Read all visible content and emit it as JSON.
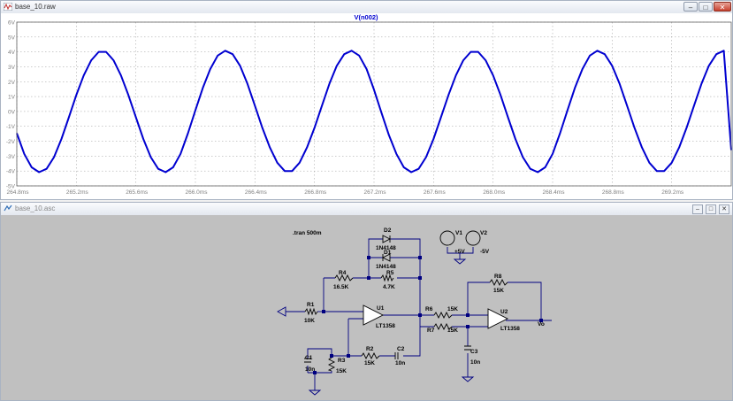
{
  "plot_window": {
    "title": "base_10.raw",
    "icon": "waveform-icon",
    "controls": [
      "–",
      "□",
      "✕"
    ],
    "trace_label": "V(n002)"
  },
  "chart_data": {
    "type": "line",
    "title": "V(n002)",
    "xlabel": "",
    "ylabel": "",
    "x_unit": "ms",
    "y_unit": "V",
    "xlim": [
      264.8,
      269.6
    ],
    "ylim": [
      -5,
      6
    ],
    "x_ticks": [
      "264.8ms",
      "265.2ms",
      "265.6ms",
      "266.0ms",
      "266.4ms",
      "266.8ms",
      "267.2ms",
      "267.6ms",
      "268.0ms",
      "268.4ms",
      "268.8ms",
      "269.2ms"
    ],
    "x_tick_values": [
      264.8,
      265.2,
      265.6,
      266.0,
      266.4,
      266.8,
      267.2,
      267.6,
      268.0,
      268.4,
      268.8,
      269.2
    ],
    "y_ticks": [
      "6V",
      "5V",
      "4V",
      "3V",
      "2V",
      "1V",
      "0V",
      "-1V",
      "-2V",
      "-3V",
      "-4V",
      "-5V"
    ],
    "y_tick_values": [
      6,
      5,
      4,
      3,
      2,
      1,
      0,
      -1,
      -2,
      -3,
      -4,
      -5
    ],
    "grid": true,
    "series": [
      {
        "name": "V(n002)",
        "color": "#0000d0",
        "x": [
          264.8,
          264.85,
          264.9,
          264.95,
          265.0,
          265.05,
          265.1,
          265.15,
          265.2,
          265.25,
          265.3,
          265.35,
          265.4,
          265.45,
          265.5,
          265.55,
          265.6,
          265.65,
          265.7,
          265.75,
          265.8,
          265.85,
          265.9,
          265.95,
          266.0,
          266.05,
          266.1,
          266.15,
          266.2,
          266.25,
          266.3,
          266.35,
          266.4,
          266.45,
          266.5,
          266.55,
          266.6,
          266.65,
          266.7,
          266.75,
          266.8,
          266.85,
          266.9,
          266.95,
          267.0,
          267.05,
          267.1,
          267.15,
          267.2,
          267.25,
          267.3,
          267.35,
          267.4,
          267.45,
          267.5,
          267.55,
          267.6,
          267.65,
          267.7,
          267.75,
          267.8,
          267.85,
          267.9,
          267.95,
          268.0,
          268.05,
          268.1,
          268.15,
          268.2,
          268.25,
          268.3,
          268.35,
          268.4,
          268.45,
          268.5,
          268.55,
          268.6,
          268.65,
          268.7,
          268.75,
          268.8,
          268.85,
          268.9,
          268.95,
          269.0,
          269.05,
          269.1,
          269.15,
          269.2,
          269.25,
          269.3,
          269.35,
          269.4,
          269.45,
          269.5,
          269.55,
          269.6
        ],
        "y": [
          -1.46,
          -2.85,
          -3.75,
          -4.08,
          -3.85,
          -3.07,
          -1.85,
          -0.39,
          1.1,
          2.42,
          3.44,
          4.0,
          4.0,
          3.44,
          2.42,
          1.1,
          -0.39,
          -1.85,
          -3.07,
          -3.85,
          -4.08,
          -3.75,
          -2.85,
          -1.46,
          0.08,
          1.58,
          2.85,
          3.75,
          4.08,
          3.85,
          3.07,
          1.85,
          0.39,
          -1.1,
          -2.42,
          -3.44,
          -4.0,
          -4.0,
          -3.44,
          -2.42,
          -1.1,
          0.39,
          1.85,
          3.07,
          3.85,
          4.08,
          3.75,
          2.85,
          1.46,
          -0.08,
          -1.58,
          -2.85,
          -3.75,
          -4.08,
          -3.85,
          -3.07,
          -1.85,
          -0.39,
          1.1,
          2.42,
          3.44,
          4.0,
          4.0,
          3.44,
          2.42,
          1.1,
          -0.39,
          -1.85,
          -3.07,
          -3.85,
          -4.08,
          -3.75,
          -2.85,
          -1.46,
          0.08,
          1.58,
          2.85,
          3.75,
          4.08,
          3.85,
          3.07,
          1.85,
          0.39,
          -1.1,
          -2.42,
          -3.44,
          -4.0,
          -4.0,
          -3.44,
          -2.42,
          -1.1,
          0.39,
          1.85,
          3.07,
          3.85,
          4.08,
          -2.6
        ]
      }
    ]
  },
  "schematic_window": {
    "title": "base_10.asc",
    "icon": "schematic-icon",
    "controls": [
      "–",
      "□",
      "✕"
    ],
    "directive": ".tran 500m",
    "components": {
      "D2": {
        "ref": "D2",
        "value": "1N4148"
      },
      "D1": {
        "ref": "D1",
        "value": "1N4148"
      },
      "R4": {
        "ref": "R4",
        "value": "16.5K"
      },
      "R5": {
        "ref": "R5",
        "value": "4.7K"
      },
      "R1": {
        "ref": "R1",
        "value": "10K"
      },
      "U1": {
        "ref": "U1",
        "value": "LT1358"
      },
      "R6": {
        "ref": "R6",
        "value": "15K"
      },
      "R7": {
        "ref": "R7",
        "value": "15K"
      },
      "R8": {
        "ref": "R8",
        "value": "15K"
      },
      "U2": {
        "ref": "U2",
        "value": "LT1358"
      },
      "R2": {
        "ref": "R2",
        "value": "15K"
      },
      "C2": {
        "ref": "C2",
        "value": "10n"
      },
      "C1": {
        "ref": "C1",
        "value": "10n"
      },
      "R3": {
        "ref": "R3",
        "value": "15K"
      },
      "C3": {
        "ref": "C3",
        "value": "10n"
      },
      "V1": {
        "ref": "V1",
        "value": "+5V"
      },
      "V2": {
        "ref": "V2",
        "value": "-5V"
      }
    },
    "output_label": "Vo"
  }
}
